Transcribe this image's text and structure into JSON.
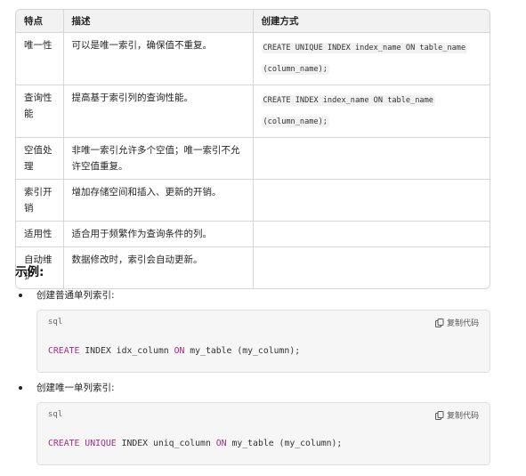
{
  "table": {
    "headers": [
      "特点",
      "描述",
      "创建方式"
    ],
    "rows": [
      {
        "feature_lines": [
          "唯一性"
        ],
        "desc_lines": [
          "可以是唯一索引，确保值不重复。"
        ],
        "code_lines": [
          "CREATE UNIQUE INDEX index_name ON table_name",
          "(column_name);"
        ]
      },
      {
        "feature_lines": [
          "查询性",
          "能"
        ],
        "desc_lines": [
          "提高基于索引列的查询性能。"
        ],
        "code_lines": [
          "CREATE INDEX index_name ON table_name",
          "(column_name);"
        ]
      },
      {
        "feature_lines": [
          "空值处",
          "理"
        ],
        "desc_lines": [
          "非唯一索引允许多个空值；唯一索引不允",
          "许空值重复。"
        ],
        "code_lines": []
      },
      {
        "feature_lines": [
          "索引开",
          "销"
        ],
        "desc_lines": [
          "增加存储空间和插入、更新的开销。"
        ],
        "code_lines": []
      },
      {
        "feature_lines": [
          "适用性"
        ],
        "desc_lines": [
          "适合用于频繁作为查询条件的列。"
        ],
        "code_lines": []
      },
      {
        "feature_lines": [
          "自动维",
          "护"
        ],
        "desc_lines": [
          "数据修改时，索引会自动更新。"
        ],
        "code_lines": []
      }
    ]
  },
  "example": {
    "heading": "示例:",
    "items": [
      {
        "label": "创建普通单列索引:",
        "lang": "sql",
        "copy_label": "复制代码",
        "tokens": [
          {
            "t": "CREATE",
            "kw": true
          },
          {
            "t": " INDEX idx_column ",
            "kw": false
          },
          {
            "t": "ON",
            "kw": true
          },
          {
            "t": " my_table (my_column);",
            "kw": false
          }
        ]
      },
      {
        "label": "创建唯一单列索引:",
        "lang": "sql",
        "copy_label": "复制代码",
        "tokens": [
          {
            "t": "CREATE",
            "kw": true
          },
          {
            "t": " ",
            "kw": false
          },
          {
            "t": "UNIQUE",
            "kw": true
          },
          {
            "t": " INDEX uniq_column ",
            "kw": false
          },
          {
            "t": "ON",
            "kw": true
          },
          {
            "t": " my_table (my_column);",
            "kw": false
          }
        ]
      }
    ]
  },
  "colors": {
    "keyword": "#a32c86",
    "header_bg": "#f2f2f2",
    "code_bg": "#f6f6f6"
  },
  "icons": {
    "copy": "copy-icon"
  }
}
